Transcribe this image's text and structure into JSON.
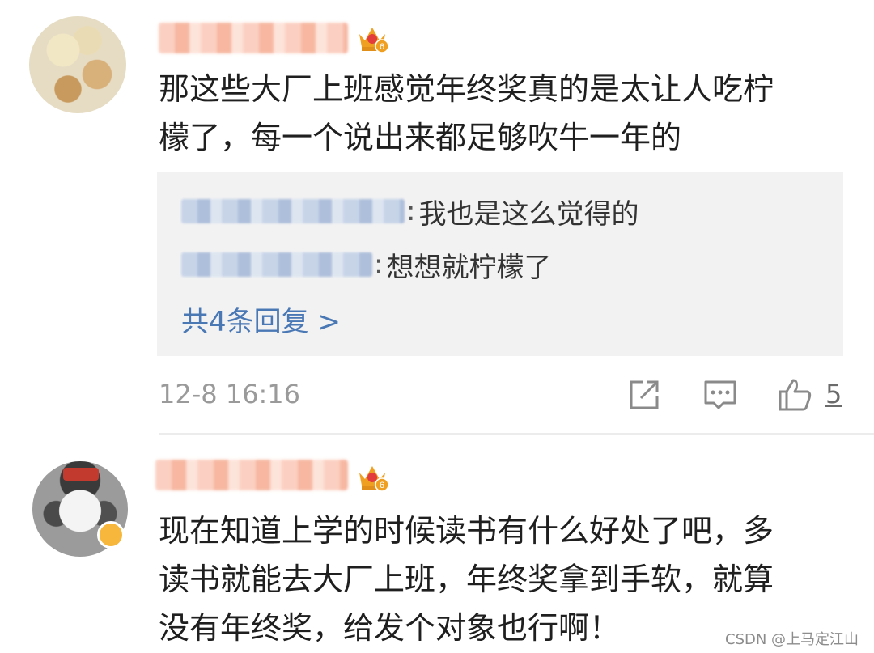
{
  "comments": [
    {
      "username": "",
      "level_badge": "6",
      "text_line1": "那这些大厂上班感觉年终奖真的是太让人吃柠",
      "text_line2": "檬了，每一个说出来都足够吹牛一年的",
      "replies": [
        {
          "name": "",
          "separator": ":",
          "text": "我也是这么觉得的"
        },
        {
          "name": "",
          "separator": ":",
          "text": "想想就柠檬了"
        }
      ],
      "more_replies_label": "共4条回复 >",
      "timestamp": "12-8 16:16",
      "like_count": "5"
    },
    {
      "username": "",
      "level_badge": "6",
      "text_line1": "现在知道上学的时候读书有什么好处了吧，多",
      "text_line2": "读书就能去大厂上班，年终奖拿到手软，就算",
      "text_line3": "没有年终奖，给发个对象也行啊！"
    }
  ],
  "watermark": "CSDN @上马定江山",
  "icons": [
    "crown-level-icon",
    "share-icon",
    "comment-icon",
    "like-icon",
    "verified-badge-icon"
  ],
  "colors": {
    "link": "#4a78b5",
    "reply_bg": "#f2f2f2",
    "timestamp": "#9a9a9a",
    "crown": "#f0a020"
  }
}
